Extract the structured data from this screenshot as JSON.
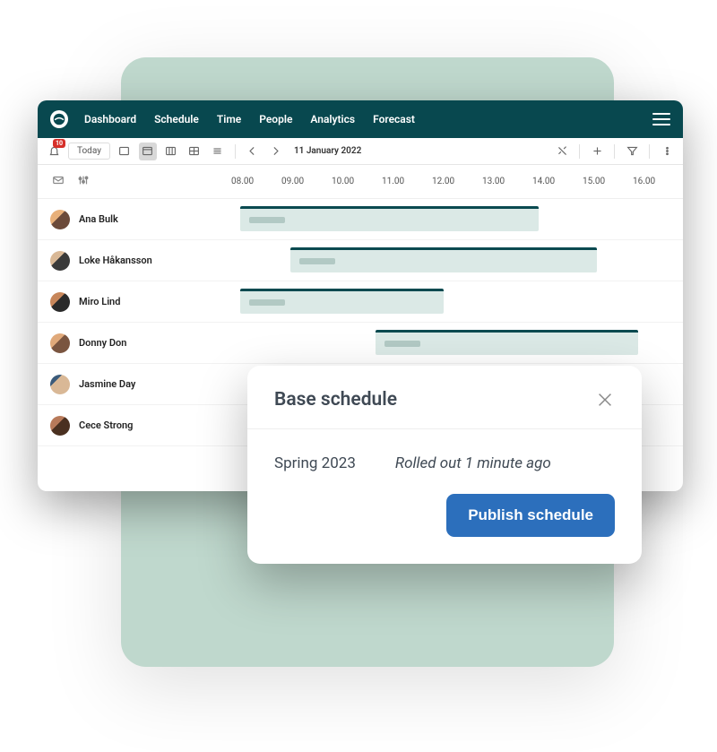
{
  "nav": {
    "items": [
      "Dashboard",
      "Schedule",
      "Time",
      "People",
      "Analytics",
      "Forecast"
    ]
  },
  "toolbar": {
    "badge_count": "10",
    "today_label": "Today",
    "date_label": "11 January 2022"
  },
  "timeline": {
    "hours": [
      "08.00",
      "09.00",
      "10.00",
      "11.00",
      "12.00",
      "13.00",
      "14.00",
      "15.00",
      "16.00"
    ]
  },
  "people": [
    {
      "name": "Ana Bulk"
    },
    {
      "name": "Loke Håkansson"
    },
    {
      "name": "Miro Lind"
    },
    {
      "name": "Donny Don"
    },
    {
      "name": "Jasmine Day"
    },
    {
      "name": "Cece Strong"
    }
  ],
  "modal": {
    "title": "Base schedule",
    "period": "Spring 2023",
    "status": "Rolled out 1 minute ago",
    "publish_label": "Publish schedule"
  }
}
